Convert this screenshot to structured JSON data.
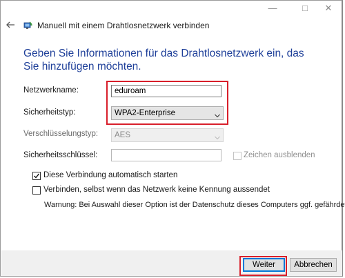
{
  "window": {
    "controls": {
      "minimize": "—",
      "maximize": "□",
      "close": "✕"
    }
  },
  "header": {
    "back_icon": "arrow-left-icon",
    "icon": "network-icon",
    "title": "Manuell mit einem Drahtlosnetzwerk verbinden"
  },
  "main": {
    "heading": "Geben Sie Informationen für das Drahtlosnetzwerk ein, das Sie hinzufügen möchten.",
    "network_name": {
      "label": "Netzwerkname:",
      "value": "eduroam"
    },
    "security_type": {
      "label": "Sicherheitstyp:",
      "value": "WPA2-Enterprise"
    },
    "encryption_type": {
      "label": "Verschlüsselungstyp:",
      "value": "AES",
      "enabled": false
    },
    "security_key": {
      "label": "Sicherheitsschlüssel:",
      "value": ""
    },
    "hide_chars": {
      "label": "Zeichen ausblenden",
      "checked": false,
      "enabled": false
    },
    "auto_start": {
      "label": "Diese Verbindung automatisch starten",
      "checked": true
    },
    "connect_hidden": {
      "label": "Verbinden, selbst wenn das Netzwerk keine Kennung aussendet",
      "checked": false
    },
    "warning": "Warnung: Bei Auswahl dieser Option ist der Datenschutz dieses Computers ggf. gefährdet."
  },
  "footer": {
    "next_label": "Weiter",
    "cancel_label": "Abbrechen"
  },
  "colors": {
    "heading": "#1e3f99",
    "highlight": "#d81e2a",
    "default_button_border": "#0078d7"
  }
}
